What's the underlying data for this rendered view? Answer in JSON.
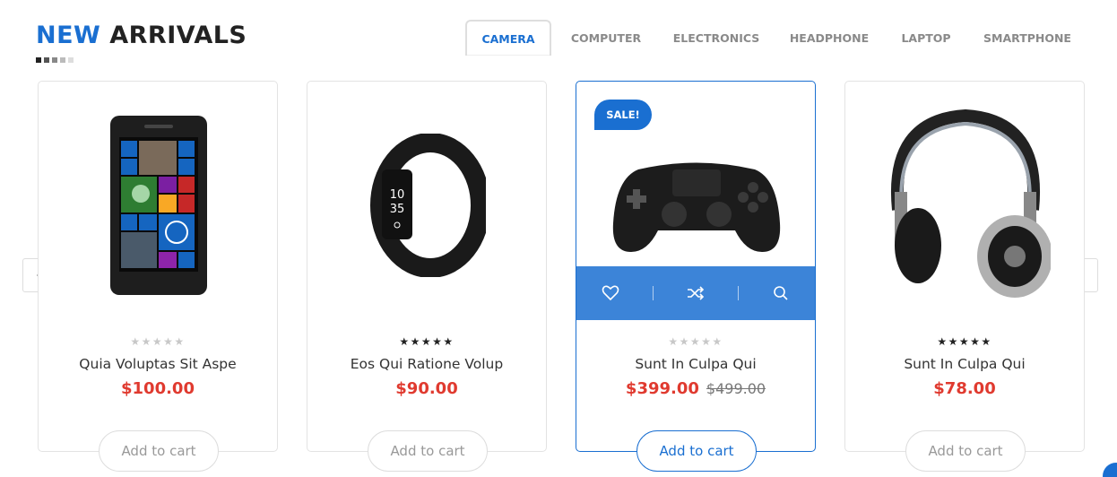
{
  "section": {
    "title_accent": "NEW",
    "title_rest": "ARRIVALS"
  },
  "tabs": [
    {
      "label": "CAMERA",
      "active": true
    },
    {
      "label": "COMPUTER",
      "active": false
    },
    {
      "label": "ELECTRONICS",
      "active": false
    },
    {
      "label": "HEADPHONE",
      "active": false
    },
    {
      "label": "LAPTOP",
      "active": false
    },
    {
      "label": "SMARTPHONE",
      "active": false
    }
  ],
  "products": [
    {
      "name": "Quia Voluptas Sit Aspe",
      "price": "$100.00",
      "rating": 0,
      "cart_label": "Add to cart",
      "image": "smartphone"
    },
    {
      "name": "Eos Qui Ratione Volup",
      "price": "$90.00",
      "rating": 5,
      "cart_label": "Add to cart",
      "image": "fitness-band"
    },
    {
      "name": "Sunt In Culpa Qui",
      "price": "$399.00",
      "old_price": "$499.00",
      "rating": 0,
      "badge": "SALE!",
      "cart_label": "Add to cart",
      "image": "game-controller"
    },
    {
      "name": "Sunt In Culpa Qui",
      "price": "$78.00",
      "rating": 5,
      "cart_label": "Add to cart",
      "image": "headphones"
    }
  ],
  "colors": {
    "accent": "#1a6fd1",
    "price": "#e03a2f"
  },
  "icons": [
    "chevron-left-icon",
    "chevron-right-icon",
    "heart-icon",
    "shuffle-icon",
    "search-icon"
  ]
}
